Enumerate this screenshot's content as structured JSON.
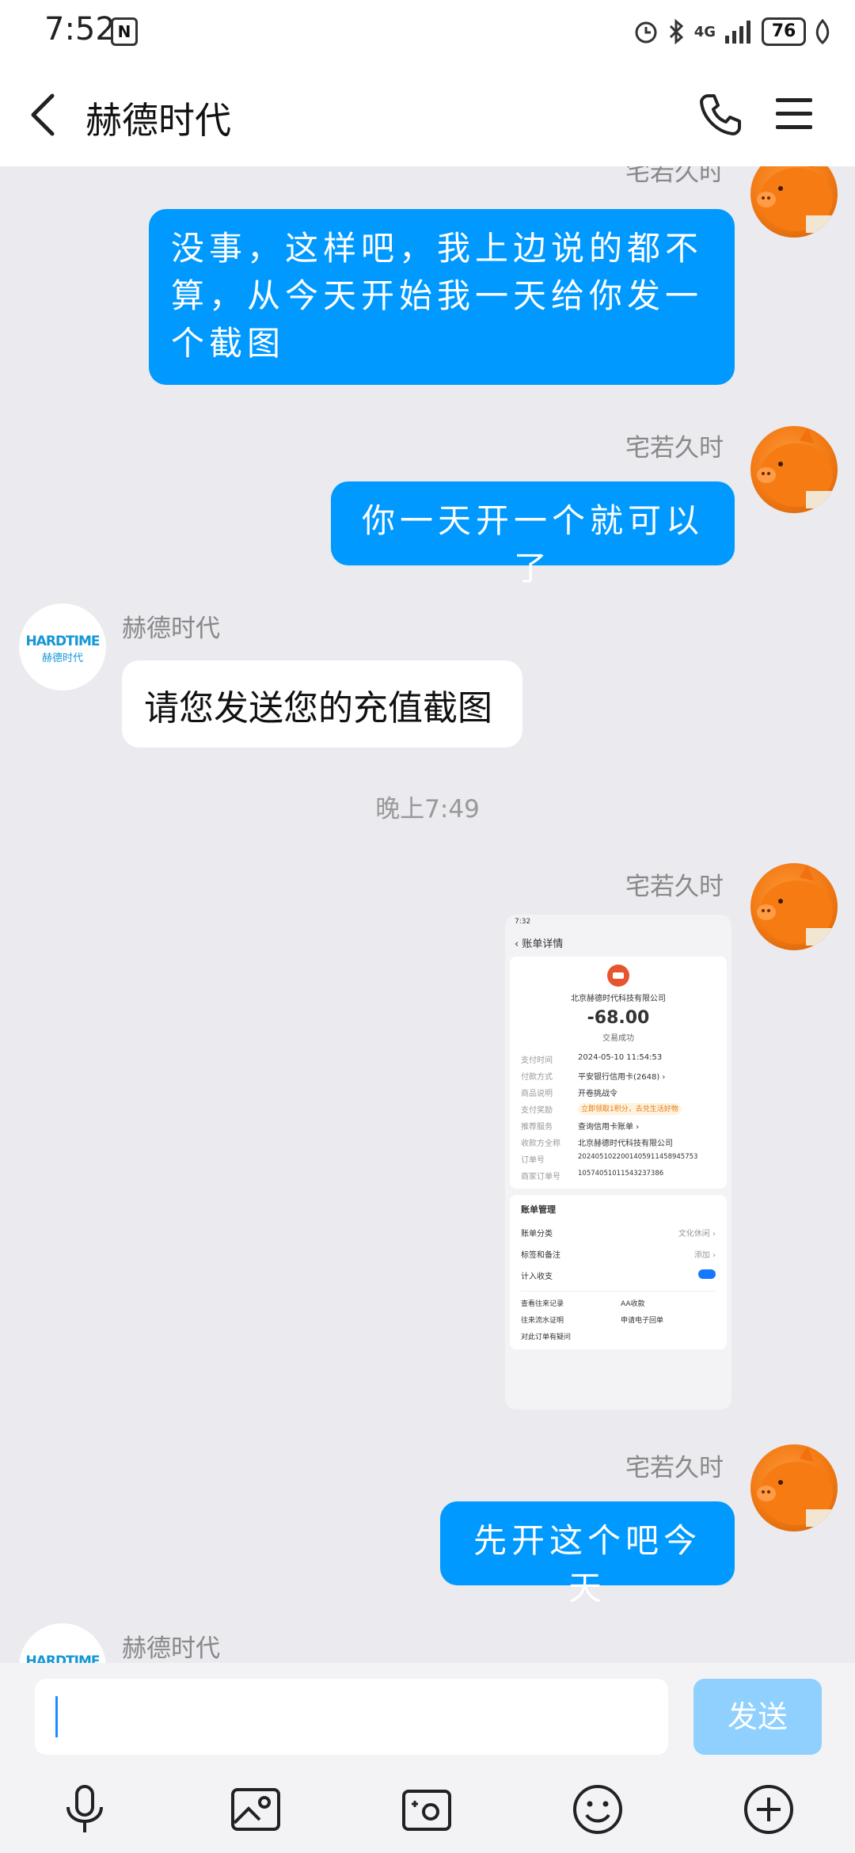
{
  "status": {
    "time": "7:52",
    "battery": "76",
    "network": "4G"
  },
  "header": {
    "title": "赫德时代"
  },
  "messages": {
    "m1": {
      "sender": "宅若久时",
      "text": "没事，这样吧，我上边说的都不算，从今天开始我一天给你发一个截图"
    },
    "m2": {
      "sender": "宅若久时",
      "text": "你一天开一个就可以了"
    },
    "m3": {
      "sender": "赫德时代",
      "text": "请您发送您的充值截图"
    },
    "timestamp": "晚上7:49",
    "m4": {
      "sender": "宅若久时"
    },
    "m5": {
      "sender": "宅若久时",
      "text": "先开这个吧今天"
    },
    "m6": {
      "sender": "赫德时代"
    }
  },
  "avatar_logo": {
    "line1": "HARDTIME",
    "line2": "赫德时代"
  },
  "receipt": {
    "status_time": "7:32",
    "page_title": "账单详情",
    "merchant": "北京赫德时代科技有限公司",
    "amount": "-68.00",
    "result": "交易成功",
    "rows": [
      {
        "k": "支付时间",
        "v": "2024-05-10 11:54:53"
      },
      {
        "k": "付款方式",
        "v": "平安银行信用卡(2648) ›"
      },
      {
        "k": "商品说明",
        "v": "开卷挑战令"
      },
      {
        "k": "支付奖励",
        "v": "立即领取1积分，去兑生活好物"
      },
      {
        "k": "推荐服务",
        "v": "查询信用卡账单 ›"
      },
      {
        "k": "收款方全称",
        "v": "北京赫德时代科技有限公司"
      },
      {
        "k": "订单号",
        "v": "20240510220014059114589457​53"
      },
      {
        "k": "商家订单号",
        "v": "1057405101154323738​6"
      }
    ],
    "mgmt_title": "账单管理",
    "mgmt_rows": [
      {
        "k": "账单分类",
        "v": "文化休闲 ›"
      },
      {
        "k": "标签和备注",
        "v": "添加 ›"
      },
      {
        "k": "计入收支",
        "v": ""
      }
    ],
    "links": [
      "查看往来记录",
      "AA收款",
      "往来流水证明",
      "申请电子回单",
      "对此订单有疑问"
    ]
  },
  "input": {
    "send_label": "发送",
    "placeholder": ""
  },
  "icons": [
    "back-icon",
    "phone-icon",
    "menu-icon",
    "mic-icon",
    "image-icon",
    "camera-icon",
    "emoji-icon",
    "plus-icon"
  ],
  "colors": {
    "bubble_me": "#0099ff",
    "send_disabled": "#8fd0ff",
    "background": "#eaeaef"
  }
}
